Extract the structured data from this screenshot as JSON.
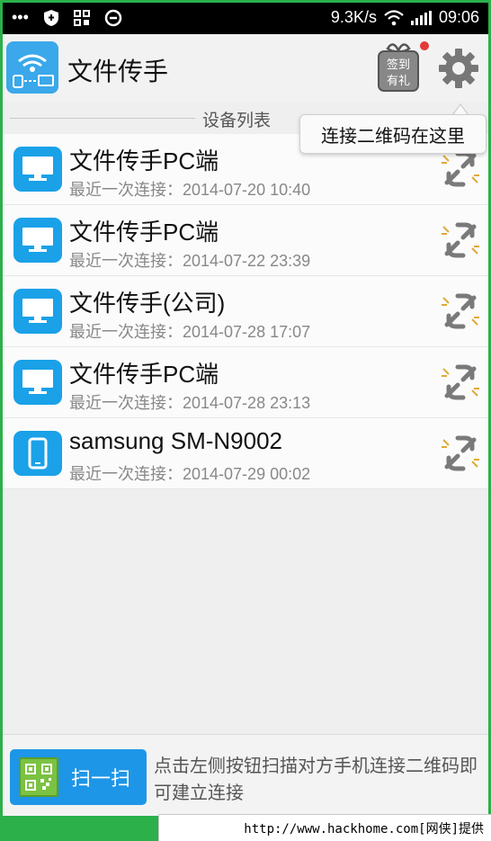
{
  "status_bar": {
    "left_glyphs": "•••",
    "speed": "9.3K/s",
    "time": "09:06"
  },
  "header": {
    "app_title": "文件传手",
    "gift_text_top": "签到",
    "gift_text_bottom": "有礼"
  },
  "section": {
    "label": "设备列表"
  },
  "tooltip": {
    "text": "连接二维码在这里"
  },
  "devices": [
    {
      "name": "文件传手PC端",
      "last_connected": "最近一次连接：2014-07-20 10:40",
      "type": "monitor"
    },
    {
      "name": "文件传手PC端",
      "last_connected": "最近一次连接：2014-07-22 23:39",
      "type": "monitor"
    },
    {
      "name": "文件传手(公司)",
      "last_connected": "最近一次连接：2014-07-28 17:07",
      "type": "monitor"
    },
    {
      "name": "文件传手PC端",
      "last_connected": "最近一次连接：2014-07-28 23:13",
      "type": "monitor"
    },
    {
      "name": "samsung SM-N9002",
      "last_connected": "最近一次连接：2014-07-29 00:02",
      "type": "phone"
    }
  ],
  "bottom": {
    "scan_label": "扫一扫",
    "hint": "点击左侧按钮扫描对方手机连接二维码即可建立连接"
  },
  "watermark": "http://www.hackhome.com[网侠]提供",
  "colors": {
    "accent_blue": "#1aa1e8",
    "frame_green": "#2bb04a",
    "status_bar": "#000000"
  }
}
